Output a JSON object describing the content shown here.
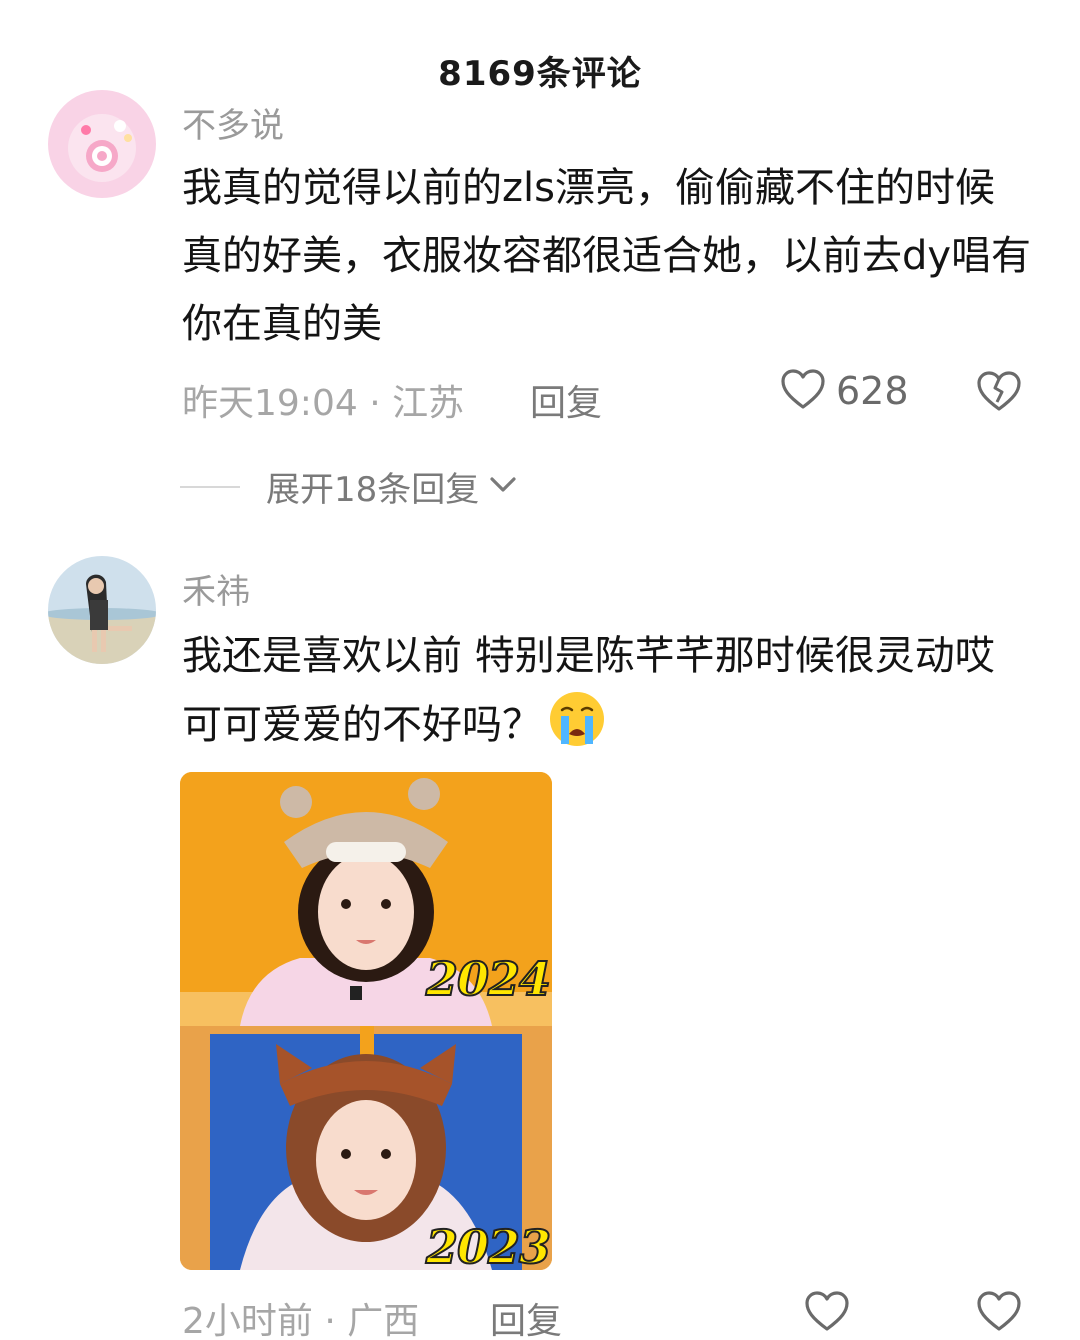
{
  "header": {
    "title": "8169条评论"
  },
  "comments": [
    {
      "username": "不多说",
      "text": "我真的觉得以前的zls漂亮，偷偷藏不住的时候真的好美，衣服妆容都很适合她，以前去dy唱有你在真的美",
      "time_location": "昨天19:04 · 江苏",
      "reply_label": "回复",
      "likes": "628",
      "expand_label": "展开18条回复"
    },
    {
      "username": "禾祎",
      "text": "我还是喜欢以前 特别是陈芊芊那时候很灵动哎 可可爱爱的不好吗？",
      "emoji": "crying-face",
      "time_location": "2小时前 · 广西",
      "reply_label": "回复",
      "image": {
        "top_label": "2024",
        "bottom_label": "2023"
      }
    }
  ],
  "icons": {
    "like": "heart-outline-icon",
    "dislike": "broken-heart-icon",
    "expand": "chevron-down-icon"
  },
  "colors": {
    "text": "#141414",
    "muted": "#9a9a9a",
    "photo_bg_top": "#f3a21c",
    "photo_bg_bottom": "#2f64c4",
    "year_label": "#ffe600"
  }
}
